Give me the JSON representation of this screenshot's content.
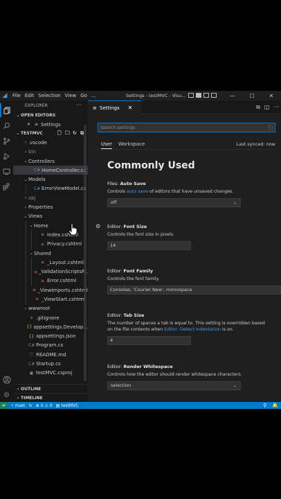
{
  "titlebar": {
    "menu": [
      "File",
      "Edit",
      "Selection",
      "View",
      "Go",
      "..."
    ],
    "title": "Settings - testMVC - Visu...",
    "window_controls": [
      "minimize-icon",
      "maximize-icon",
      "close-icon"
    ]
  },
  "activity_bar": [
    "explorer-icon",
    "search-icon",
    "source-control-icon",
    "run-debug-icon",
    "remote-explorer-icon",
    "extensions-icon",
    "accounts-icon",
    "manage-gear-icon"
  ],
  "sidebar": {
    "header": "EXPLORER",
    "open_editors_label": "OPEN EDITORS",
    "open_editors": [
      {
        "label": "Settings",
        "icon": "close-icon"
      }
    ],
    "project_label": "TESTMVC",
    "tree": [
      {
        "label": ".vscode",
        "type": "folder",
        "depth": 1,
        "open": false
      },
      {
        "label": "bin",
        "type": "folder",
        "depth": 1,
        "open": false,
        "dim": true
      },
      {
        "label": "Controllers",
        "type": "folder",
        "depth": 1,
        "open": true
      },
      {
        "label": "HomeController.cs",
        "type": "cs",
        "depth": 2,
        "selected": true
      },
      {
        "label": "Models",
        "type": "folder",
        "depth": 1,
        "open": true
      },
      {
        "label": "ErrorViewModel.cs",
        "type": "cs",
        "depth": 2
      },
      {
        "label": "obj",
        "type": "folder",
        "depth": 1,
        "open": false,
        "dim": true
      },
      {
        "label": "Properties",
        "type": "folder",
        "depth": 1,
        "open": false
      },
      {
        "label": "Views",
        "type": "folder",
        "depth": 1,
        "open": true
      },
      {
        "label": "Home",
        "type": "folder",
        "depth": 2,
        "open": true
      },
      {
        "label": "Index.cshtml",
        "type": "html",
        "depth": 3
      },
      {
        "label": "Privacy.cshtml",
        "type": "html",
        "depth": 3
      },
      {
        "label": "Shared",
        "type": "folder",
        "depth": 2,
        "open": true
      },
      {
        "label": "_Layout.cshtml",
        "type": "html",
        "depth": 3
      },
      {
        "label": "_ValidationScriptsP...",
        "type": "html",
        "depth": 3
      },
      {
        "label": "Error.cshtml",
        "type": "html",
        "depth": 3
      },
      {
        "label": "_ViewImports.cshtml",
        "type": "html",
        "depth": 2
      },
      {
        "label": "_ViewStart.cshtml",
        "type": "html",
        "depth": 2
      },
      {
        "label": "wwwroot",
        "type": "folder",
        "depth": 1,
        "open": false
      },
      {
        "label": ".gitignore",
        "type": "git",
        "depth": 1
      },
      {
        "label": "appsettings.Develop...",
        "type": "json",
        "depth": 1
      },
      {
        "label": "appsettings.json",
        "type": "json",
        "depth": 1
      },
      {
        "label": "Program.cs",
        "type": "cs",
        "depth": 1
      },
      {
        "label": "README.md",
        "type": "md",
        "depth": 1
      },
      {
        "label": "Startup.cs",
        "type": "cs",
        "depth": 1
      },
      {
        "label": "testMVC.csproj",
        "type": "proj",
        "depth": 1
      }
    ],
    "outline_label": "OUTLINE",
    "timeline_label": "TIMELINE"
  },
  "editor": {
    "tab_label": "Settings",
    "search_placeholder": "Search settings",
    "scope_user": "User",
    "scope_workspace": "Workspace",
    "last_synced": "Last synced: now",
    "heading": "Commonly Used",
    "settings": [
      {
        "category": "Files: ",
        "name": "Auto Save",
        "desc_pre": "Controls ",
        "desc_link": "auto save",
        "desc_post": " of editors that have unsaved changes.",
        "control": "select",
        "value": "off"
      },
      {
        "category": "Editor: ",
        "name": "Font Size",
        "desc_pre": "Controls the font size in pixels.",
        "desc_link": "",
        "desc_post": "",
        "control": "input",
        "value": "14"
      },
      {
        "category": "Editor: ",
        "name": "Font Family",
        "desc_pre": "Controls the font family.",
        "desc_link": "",
        "desc_post": "",
        "control": "input",
        "value": "Consolas, 'Courier New', monospace"
      },
      {
        "category": "Editor: ",
        "name": "Tab Size",
        "desc_pre": "The number of spaces a tab is equal to. This setting is overridden based",
        "desc_line2_pre": "on the file contents when ",
        "desc_link": "Editor: Detect Indentation",
        "desc_post": " is on.",
        "control": "input",
        "value": "4"
      },
      {
        "category": "Editor: ",
        "name": "Render Whitespace",
        "desc_pre": "Controls how the editor should render whitespace characters.",
        "desc_link": "",
        "desc_post": "",
        "control": "select",
        "value": "selection"
      }
    ]
  },
  "statusbar": {
    "branch": "main",
    "errors": "0",
    "warnings": "0",
    "project": "testMVC"
  },
  "colors": {
    "accent": "#0078d4",
    "statusbar": "#007acc",
    "link": "#3c9dea"
  }
}
